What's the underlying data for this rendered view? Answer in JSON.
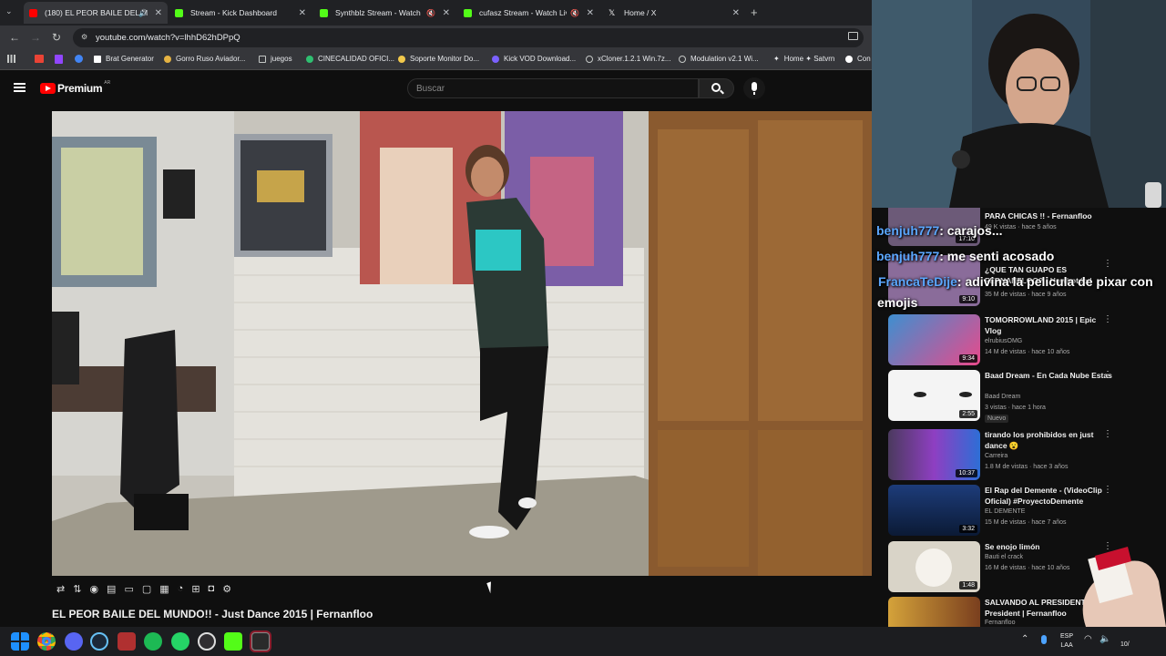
{
  "tabs": [
    {
      "title": "(180) EL PEOR BAILE DEL M",
      "active": true,
      "icon_color": "#ff0000",
      "icon": "youtube-icon"
    },
    {
      "title": "Stream - Kick Dashboard",
      "active": false,
      "icon_color": "#53fc18",
      "icon": "kick-icon"
    },
    {
      "title": "Synthblz Stream - Watch Li",
      "active": false,
      "icon_color": "#53fc18",
      "icon": "kick-icon"
    },
    {
      "title": "cufasz Stream - Watch Live",
      "active": false,
      "icon_color": "#53fc18",
      "icon": "kick-icon"
    },
    {
      "title": "Home / X",
      "active": false,
      "icon_color": "#ffffff",
      "icon": "x-icon"
    }
  ],
  "address": {
    "url": "youtube.com/watch?v=lhhD62hDPpQ"
  },
  "bookmarks": [
    {
      "label": "Brat Generator"
    },
    {
      "label": "Gorro Ruso Aviador..."
    },
    {
      "label": "juegos"
    },
    {
      "label": "CINECALIDAD OFICI..."
    },
    {
      "label": "Soporte Monitor Do..."
    },
    {
      "label": "Kick VOD Download..."
    },
    {
      "label": "xCloner.1.2.1 Win.7z..."
    },
    {
      "label": "Modulation v2.1 Wi..."
    },
    {
      "label": "Home ✦ Satvrn"
    },
    {
      "label": "Con"
    }
  ],
  "youtube": {
    "logo": "Premium",
    "region": "AR",
    "search_placeholder": "Buscar"
  },
  "video": {
    "title": "EL PEOR BAILE DEL MUNDO!! - Just Dance 2015 | Fernanfloo"
  },
  "chat": [
    {
      "user": "benjuh777",
      "msg": ": carajos..."
    },
    {
      "user": "benjuh777",
      "msg": ": me senti acosado"
    },
    {
      "user": "FrancaTeDije",
      "msg": ": adivina la pelicula de pixar con"
    },
    {
      "user": "",
      "msg": "emojis"
    }
  ],
  "partial_recs": [
    {
      "title": "PARA CHICAS !! - Fernanfloo",
      "meta": "49 K vistas · hace 5 años",
      "duration": "17:10"
    },
    {
      "title": "¿QUE TAN GUAPO ES FERNANFLOO? - Howhot.io |",
      "meta": "35 M de vistas · hace 9 años",
      "duration": "9:10"
    }
  ],
  "recommendations": [
    {
      "title": "TOMORROWLAND 2015 | Epic Vlog",
      "channel": "elrubiusOMG",
      "meta": "14 M de vistas · hace 10 años",
      "duration": "9:34",
      "badge": ""
    },
    {
      "title": "Baad Dream - En Cada Nube Estas",
      "channel": "Baad Dream",
      "meta": "3 vistas · hace 1 hora",
      "duration": "2:55",
      "badge": "Nuevo"
    },
    {
      "title": "tirando los prohibidos en just dance 😮",
      "channel": "Carreira",
      "meta": "1.8 M de vistas · hace 3 años",
      "duration": "10:37",
      "badge": ""
    },
    {
      "title": "El Rap del Demente - (VideoClip Oficial) #ProyectoDemente",
      "channel": "EL DEMENTE",
      "meta": "15 M de vistas · hace 7 años",
      "duration": "3:32",
      "badge": ""
    },
    {
      "title": "Se enojo limón",
      "channel": "Bauti el crack",
      "meta": "16 M de vistas · hace 10 años",
      "duration": "1:48",
      "badge": ""
    },
    {
      "title": "SALVANDO AL PRESIDENTE Mr. President | Fernanfloo",
      "channel": "Fernanfloo",
      "meta": "",
      "duration": "",
      "badge": ""
    }
  ],
  "taskbar": {
    "lang": "ESP",
    "region": "LAA",
    "time": "10/"
  },
  "colors": {
    "accent": "#ff0000",
    "kick": "#53fc18",
    "chat_user": "#5ba7ff"
  }
}
